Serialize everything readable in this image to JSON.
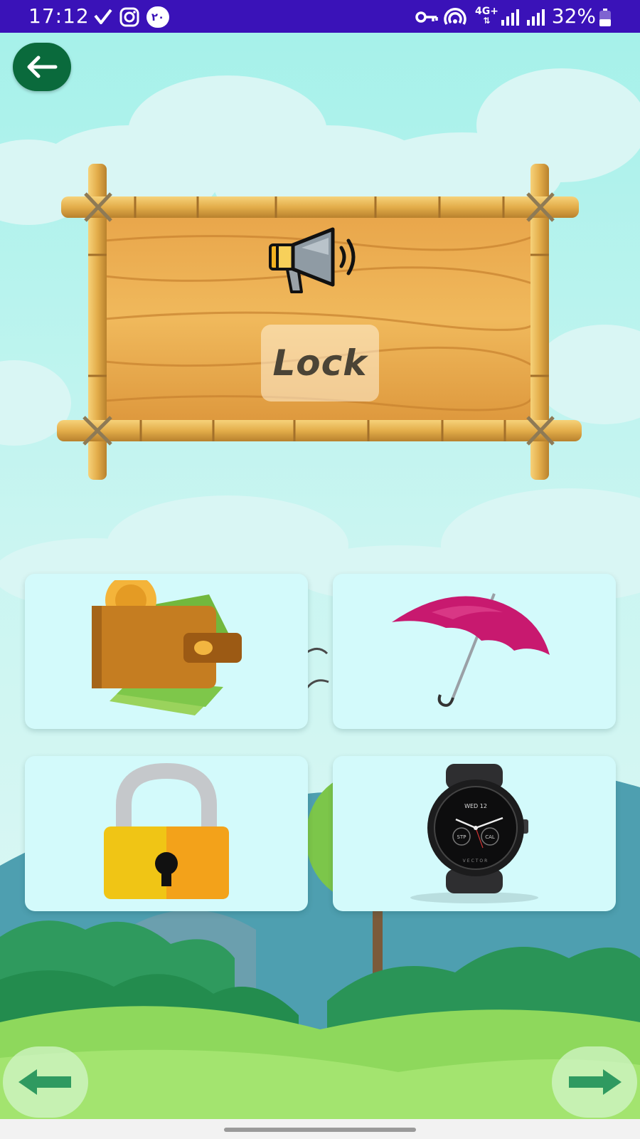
{
  "status_bar": {
    "time": "17:12",
    "battery_percent": "32%",
    "icons": [
      "vpn-check-icon",
      "instagram-icon",
      "notification-badge-icon",
      "key-icon",
      "hotspot-icon",
      "4g-icon",
      "signal-icon",
      "signal-icon",
      "battery-icon"
    ],
    "notification_badge": "۲۰",
    "network_label": "4G+"
  },
  "top_bar": {
    "back_icon": "arrow-left-icon"
  },
  "board": {
    "speaker_icon": "megaphone-icon",
    "word": "Lock"
  },
  "options": [
    {
      "name": "wallet",
      "icon": "wallet-icon"
    },
    {
      "name": "umbrella",
      "icon": "umbrella-icon"
    },
    {
      "name": "lock",
      "icon": "padlock-icon"
    },
    {
      "name": "watch",
      "icon": "wristwatch-icon"
    }
  ],
  "watch_face": {
    "date": "WED 12",
    "left_dial": "STP",
    "right_dial": "CAL",
    "brand": "VECTOR"
  },
  "nav": {
    "prev_icon": "arrow-left-icon",
    "next_icon": "arrow-right-icon"
  },
  "colors": {
    "status_bar": "#3a12b8",
    "back_button": "#0a6a3c",
    "card_bg": "#d3fafb",
    "sky": "#bff2ee"
  }
}
